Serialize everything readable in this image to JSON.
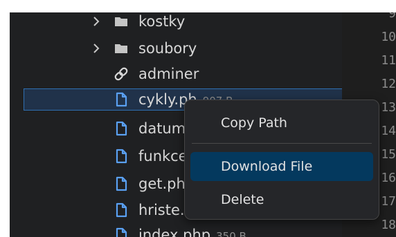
{
  "explorer": {
    "items": [
      {
        "name": "kostky",
        "type": "folder",
        "size": ""
      },
      {
        "name": "soubory",
        "type": "folder",
        "size": ""
      },
      {
        "name": "adminer",
        "type": "link",
        "size": ""
      },
      {
        "name": "cykly.ph",
        "type": "file",
        "size": "907 B"
      },
      {
        "name": "datum",
        "type": "file",
        "size": ""
      },
      {
        "name": "funkce",
        "type": "file",
        "size": ""
      },
      {
        "name": "get.ph",
        "type": "file",
        "size": ""
      },
      {
        "name": "hriste.",
        "type": "file",
        "size": ""
      },
      {
        "name": "index.php",
        "type": "file",
        "size": "350 B"
      }
    ]
  },
  "line_numbers": [
    "9",
    "10",
    "11",
    "12",
    "13",
    "14",
    "15",
    "16",
    "17",
    "18"
  ],
  "context_menu": {
    "copy_path": "Copy Path",
    "download_file": "Download File",
    "delete": "Delete"
  },
  "colors": {
    "background": "#1f2022",
    "selection_border": "#2f6fb0",
    "menu_highlight": "#04395e",
    "file_icon": "#5aa0f2"
  }
}
